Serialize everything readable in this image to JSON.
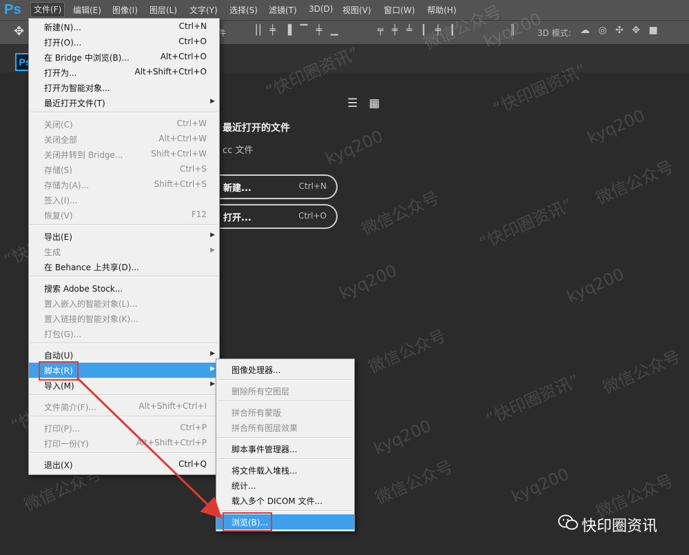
{
  "app": {
    "logo": "Ps",
    "doc_logo": "Ps"
  },
  "menubar": {
    "items": [
      "文件(F)",
      "编辑(E)",
      "图像(I)",
      "图层(L)",
      "文字(Y)",
      "选择(S)",
      "滤镜(T)",
      "3D(D)",
      "视图(V)",
      "窗口(W)",
      "帮助(H)"
    ],
    "active": "文件(F)"
  },
  "toolbar": {
    "move_tool": "✥",
    "partial_label": "件",
    "mode_3d_label": "3D 模式:"
  },
  "start_panel": {
    "list_view_icon": "list-icon",
    "grid_view_icon": "grid-icon",
    "recent_files_title": "最近打开的文件",
    "cc_files_label": "cc 文件",
    "new_button": {
      "label": "新建...",
      "shortcut": "Ctrl+N"
    },
    "open_button": {
      "label": "打开...",
      "shortcut": "Ctrl+O"
    }
  },
  "file_menu": {
    "items": [
      {
        "label": "新建(N)...",
        "shortcut": "Ctrl+N"
      },
      {
        "label": "打开(O)...",
        "shortcut": "Ctrl+O"
      },
      {
        "label": "在 Bridge 中浏览(B)...",
        "shortcut": "Alt+Ctrl+O"
      },
      {
        "label": "打开为...",
        "shortcut": "Alt+Shift+Ctrl+O"
      },
      {
        "label": "打开为智能对象...",
        "shortcut": ""
      },
      {
        "label": "最近打开文件(T)",
        "shortcut": ""
      },
      {
        "label": "关闭(C)",
        "shortcut": "Ctrl+W"
      },
      {
        "label": "关闭全部",
        "shortcut": "Alt+Ctrl+W"
      },
      {
        "label": "关闭并转到 Bridge...",
        "shortcut": "Shift+Ctrl+W"
      },
      {
        "label": "存储(S)",
        "shortcut": "Ctrl+S"
      },
      {
        "label": "存储为(A)...",
        "shortcut": "Shift+Ctrl+S"
      },
      {
        "label": "签入(I)...",
        "shortcut": ""
      },
      {
        "label": "恢复(V)",
        "shortcut": "F12"
      },
      {
        "label": "导出(E)",
        "shortcut": ""
      },
      {
        "label": "生成",
        "shortcut": ""
      },
      {
        "label": "在 Behance 上共享(D)...",
        "shortcut": ""
      },
      {
        "label": "搜索 Adobe Stock...",
        "shortcut": ""
      },
      {
        "label": "置入嵌入的智能对象(L)...",
        "shortcut": ""
      },
      {
        "label": "置入链接的智能对象(K)...",
        "shortcut": ""
      },
      {
        "label": "打包(G)...",
        "shortcut": ""
      },
      {
        "label": "自动(U)",
        "shortcut": ""
      },
      {
        "label": "脚本(R)",
        "shortcut": ""
      },
      {
        "label": "导入(M)",
        "shortcut": ""
      },
      {
        "label": "文件简介(F)...",
        "shortcut": "Alt+Shift+Ctrl+I"
      },
      {
        "label": "打印(P)...",
        "shortcut": "Ctrl+P"
      },
      {
        "label": "打印一份(Y)",
        "shortcut": "Alt+Shift+Ctrl+P"
      },
      {
        "label": "退出(X)",
        "shortcut": "Ctrl+Q"
      }
    ]
  },
  "scripts_submenu": {
    "items": [
      {
        "label": "图像处理器..."
      },
      {
        "label": "删除所有空图层"
      },
      {
        "label": "拼合所有蒙版"
      },
      {
        "label": "拼合所有图层效果"
      },
      {
        "label": "脚本事件管理器..."
      },
      {
        "label": "将文件载入堆栈..."
      },
      {
        "label": "统计..."
      },
      {
        "label": "载入多个 DICOM 文件..."
      },
      {
        "label": "浏览(B)..."
      }
    ]
  },
  "annotation": {
    "color": "#e03a2f"
  },
  "watermarks": {
    "text_a": "kyq200",
    "text_b": "“快印圈资讯”",
    "text_c": "微信公众号"
  },
  "brand": {
    "text": "快印圈资讯",
    "icon": "wechat-icon"
  }
}
